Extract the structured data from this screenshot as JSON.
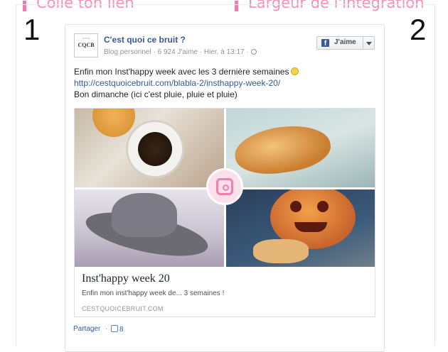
{
  "labels": {
    "step1_label": "Colle ton lien",
    "step2_label": "Largeur de l'intégration",
    "step1_number": "1",
    "step2_number": "2"
  },
  "post": {
    "avatar_text": "CQCB",
    "page_name": "C'est quoi ce bruit ?",
    "meta": "Blog personnel · 6 924 J'aime · Hier, à 13:17 ·",
    "like_button_label": "J'aime",
    "text_line1": "Enfin mon Inst'happy week avec les 3 dernière semaines",
    "text_link": "http://cestquoicebruit.com/blabla-2/insthappy-week-20/",
    "text_line3": "Bon dimanche (ici c'est pluie, pluie et pluie)",
    "attachment": {
      "title": "Inst'happy week 20",
      "description": "Enfin mon inst'happy week de... 3 semaines !",
      "domain": "CESTQUOICEBRUIT.COM"
    },
    "footer": {
      "share_label": "Partager",
      "separator": "·",
      "like_count": "8"
    }
  },
  "colors": {
    "accent_pink": "#f27aad",
    "facebook_blue": "#365899",
    "fb_brand": "#3b5998"
  },
  "icons": [
    "globe-icon",
    "facebook-icon",
    "caret-down-icon",
    "smiley-icon",
    "instagram-icon",
    "thumbs-up-icon"
  ]
}
